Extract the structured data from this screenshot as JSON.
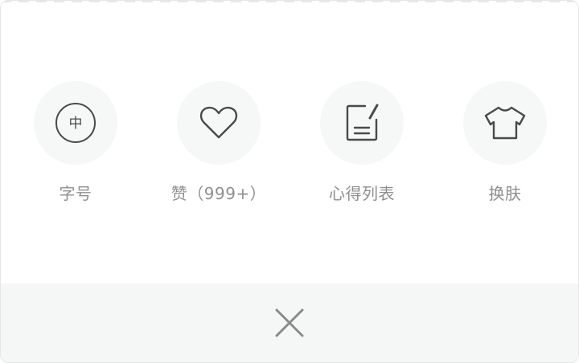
{
  "options": [
    {
      "name": "font-size",
      "label": "字号",
      "icon": "font-size-icon",
      "icon_text": "中"
    },
    {
      "name": "like",
      "label": "赞（999+）",
      "icon": "heart-icon"
    },
    {
      "name": "notes-list",
      "label": "心得列表",
      "icon": "edit-note-icon"
    },
    {
      "name": "skin",
      "label": "换肤",
      "icon": "tshirt-icon"
    }
  ],
  "colors": {
    "icon_stroke": "#4a4a4a",
    "label": "#8f8f8f",
    "circle_bg": "#f6f7f7",
    "close_bar_bg": "#f5f6f6",
    "close_icon": "#8a8a8a"
  },
  "close": {
    "icon": "close-icon"
  }
}
